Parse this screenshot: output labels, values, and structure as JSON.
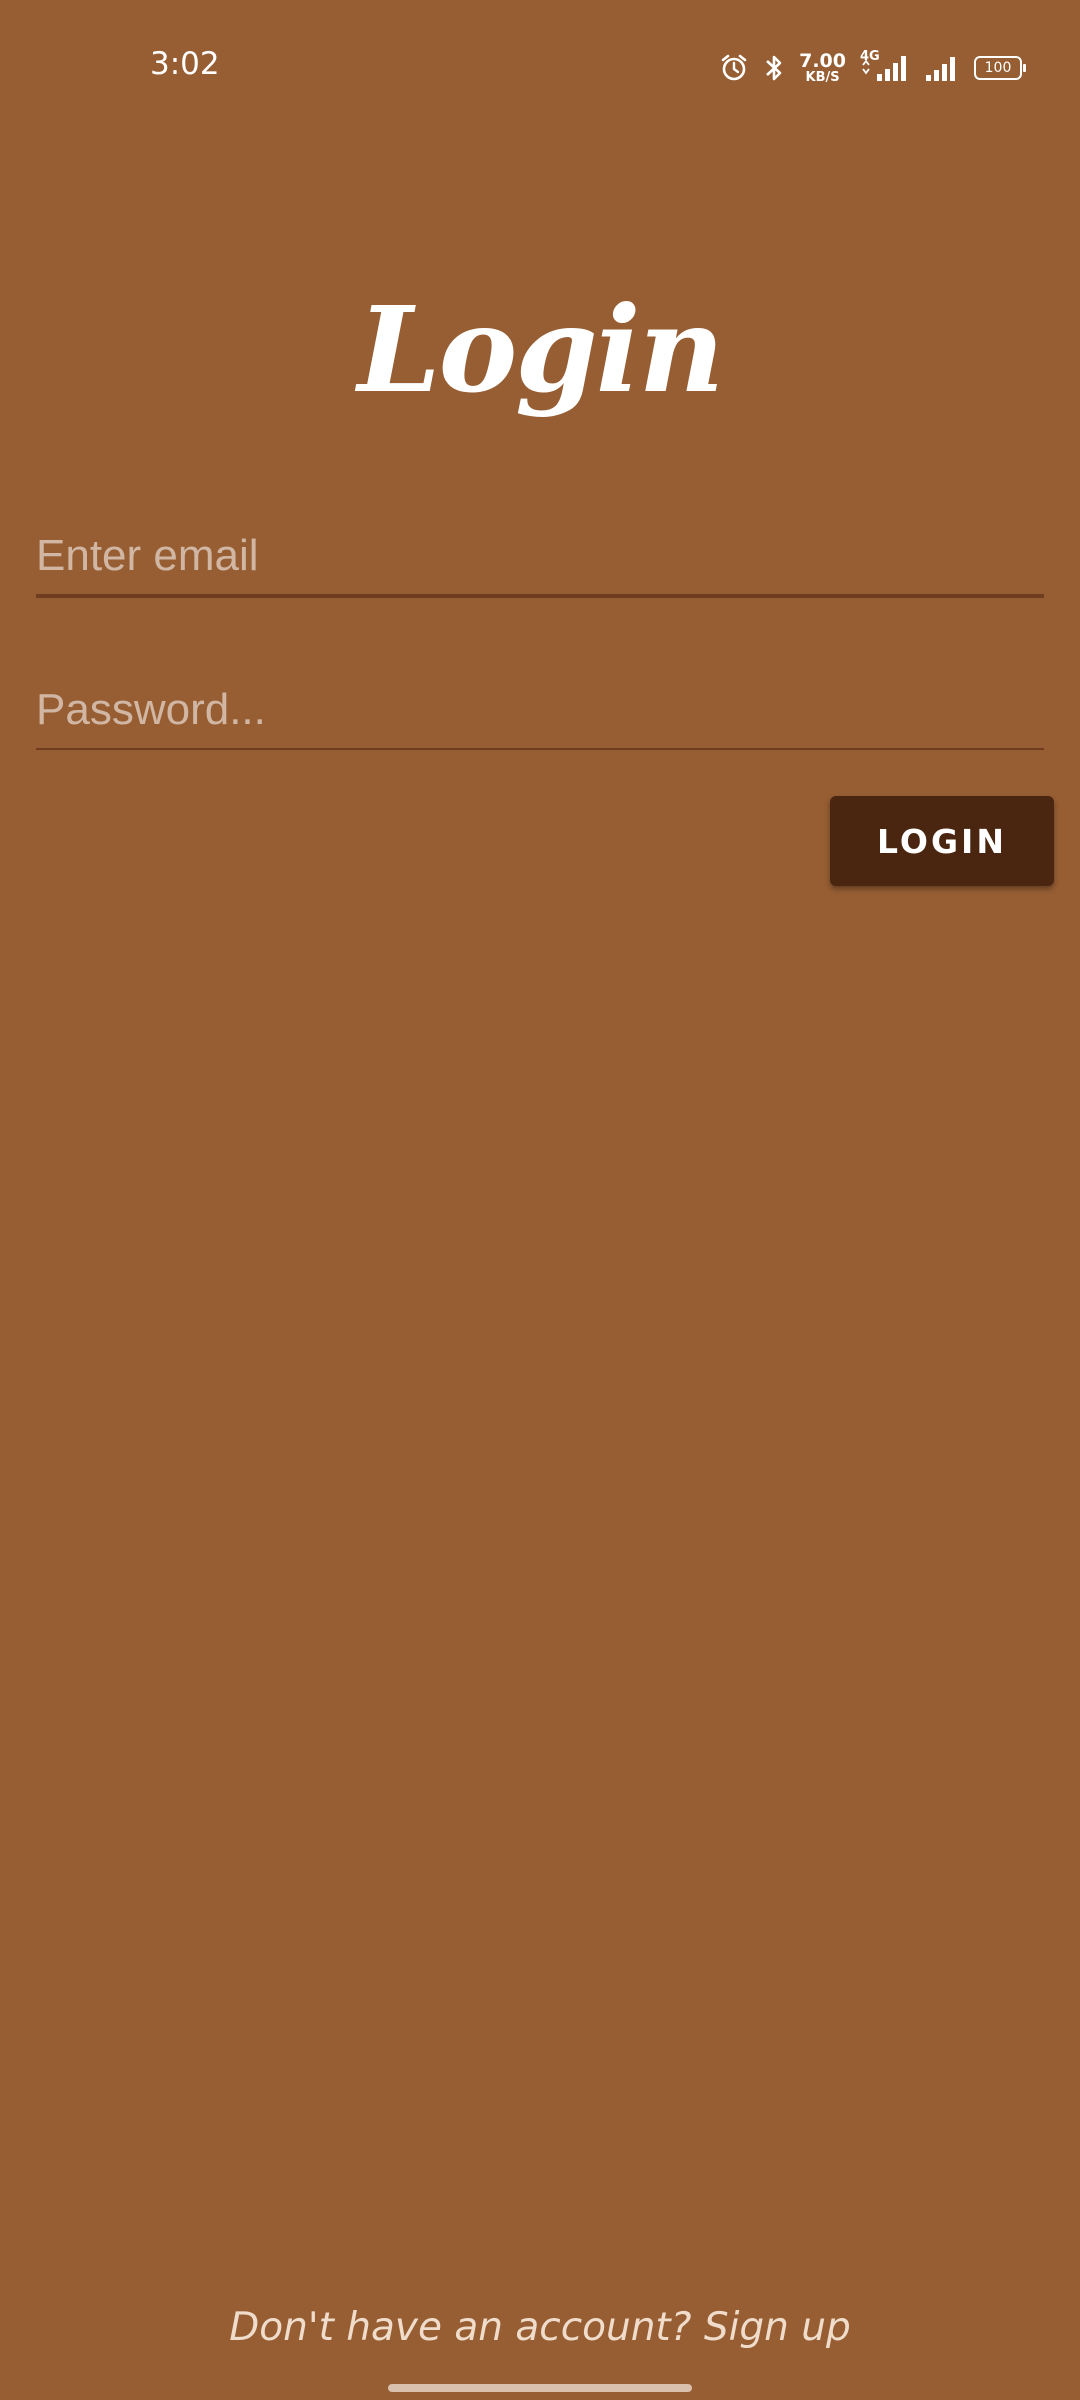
{
  "status_bar": {
    "time": "3:02",
    "net_speed_value": "7.00",
    "net_speed_unit": "KB/S",
    "network_type": "4G",
    "battery": "100",
    "icons": [
      "alarm-icon",
      "bluetooth-icon",
      "signal-4g-icon",
      "signal-icon",
      "battery-icon"
    ]
  },
  "screen": {
    "title": "Login",
    "background_color": "#975e33"
  },
  "form": {
    "email_placeholder": "Enter email",
    "email_value": "",
    "password_placeholder": "Password...",
    "password_value": "",
    "login_label": "LOGIN",
    "login_color": "#4a2510"
  },
  "footer": {
    "signup_text": "Don't have an account? Sign up"
  }
}
